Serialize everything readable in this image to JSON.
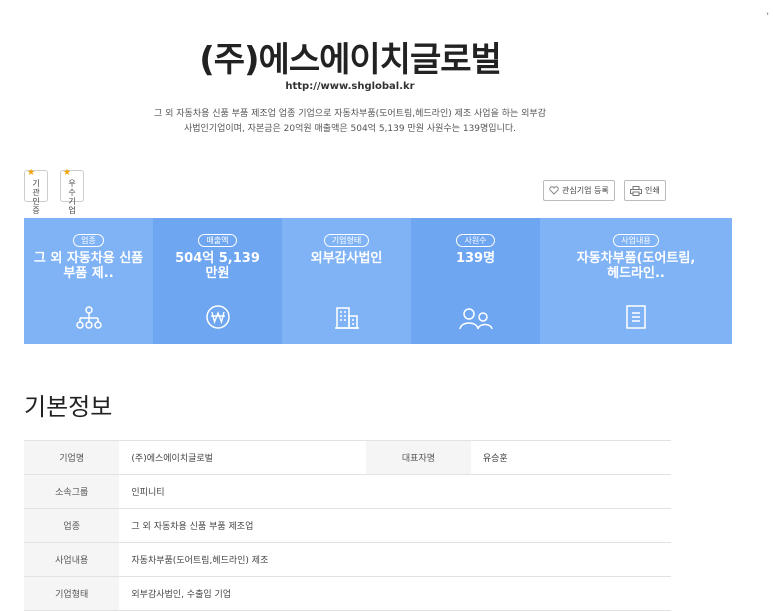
{
  "company": {
    "name": "(주)에스에이치글로벌",
    "url": "http://www.shglobal.kr",
    "description": "그 외 자동차용 신품 부품 제조업 업종 기업으로 자동차부품(도어트림,헤드라인) 제조 사업을 하는 외부감사법인기업이며, 자본금은 20억원 매출액은 504억 5,139 만원 사원수는 139명입니다."
  },
  "badges": [
    {
      "label": "기관인증",
      "icon": "star-icon"
    },
    {
      "label": "우수기업",
      "icon": "star-icon"
    }
  ],
  "actions": {
    "favorite_label": "관심기업 등록",
    "print_label": "인쇄"
  },
  "stats": [
    {
      "tag": "업종",
      "value": "그 외 자동차용 신품 부품 제..",
      "icon": "org-chart-icon",
      "color": "#7fb3f5"
    },
    {
      "tag": "매출액",
      "value": "504억 5,139만원",
      "icon": "won-icon",
      "color": "#6ea6f2"
    },
    {
      "tag": "기업형태",
      "value": "외부감사법인",
      "icon": "building-icon",
      "color": "#7fb3f5"
    },
    {
      "tag": "사원수",
      "value": "139명",
      "icon": "people-icon",
      "color": "#6ea6f2"
    },
    {
      "tag": "사업내용",
      "value": "자동차부품(도어트림,헤드라인..",
      "icon": "document-icon",
      "color": "#7fb3f5"
    }
  ],
  "basic_info": {
    "title": "기본정보",
    "rows": [
      {
        "label": "기업명",
        "value": "(주)에스에이치글로벌",
        "label2": "대표자명",
        "value2": "유승훈"
      },
      {
        "label": "소속그룹",
        "value": "인피니티"
      },
      {
        "label": "업종",
        "value": "그 외 자동차용 신품 부품 제조업"
      },
      {
        "label": "사업내용",
        "value": "자동차부품(도어트림,헤드라인) 제조"
      },
      {
        "label": "기업형태",
        "value": "외부감사법인, 수출입 기업"
      }
    ]
  },
  "corner_mark": "'"
}
